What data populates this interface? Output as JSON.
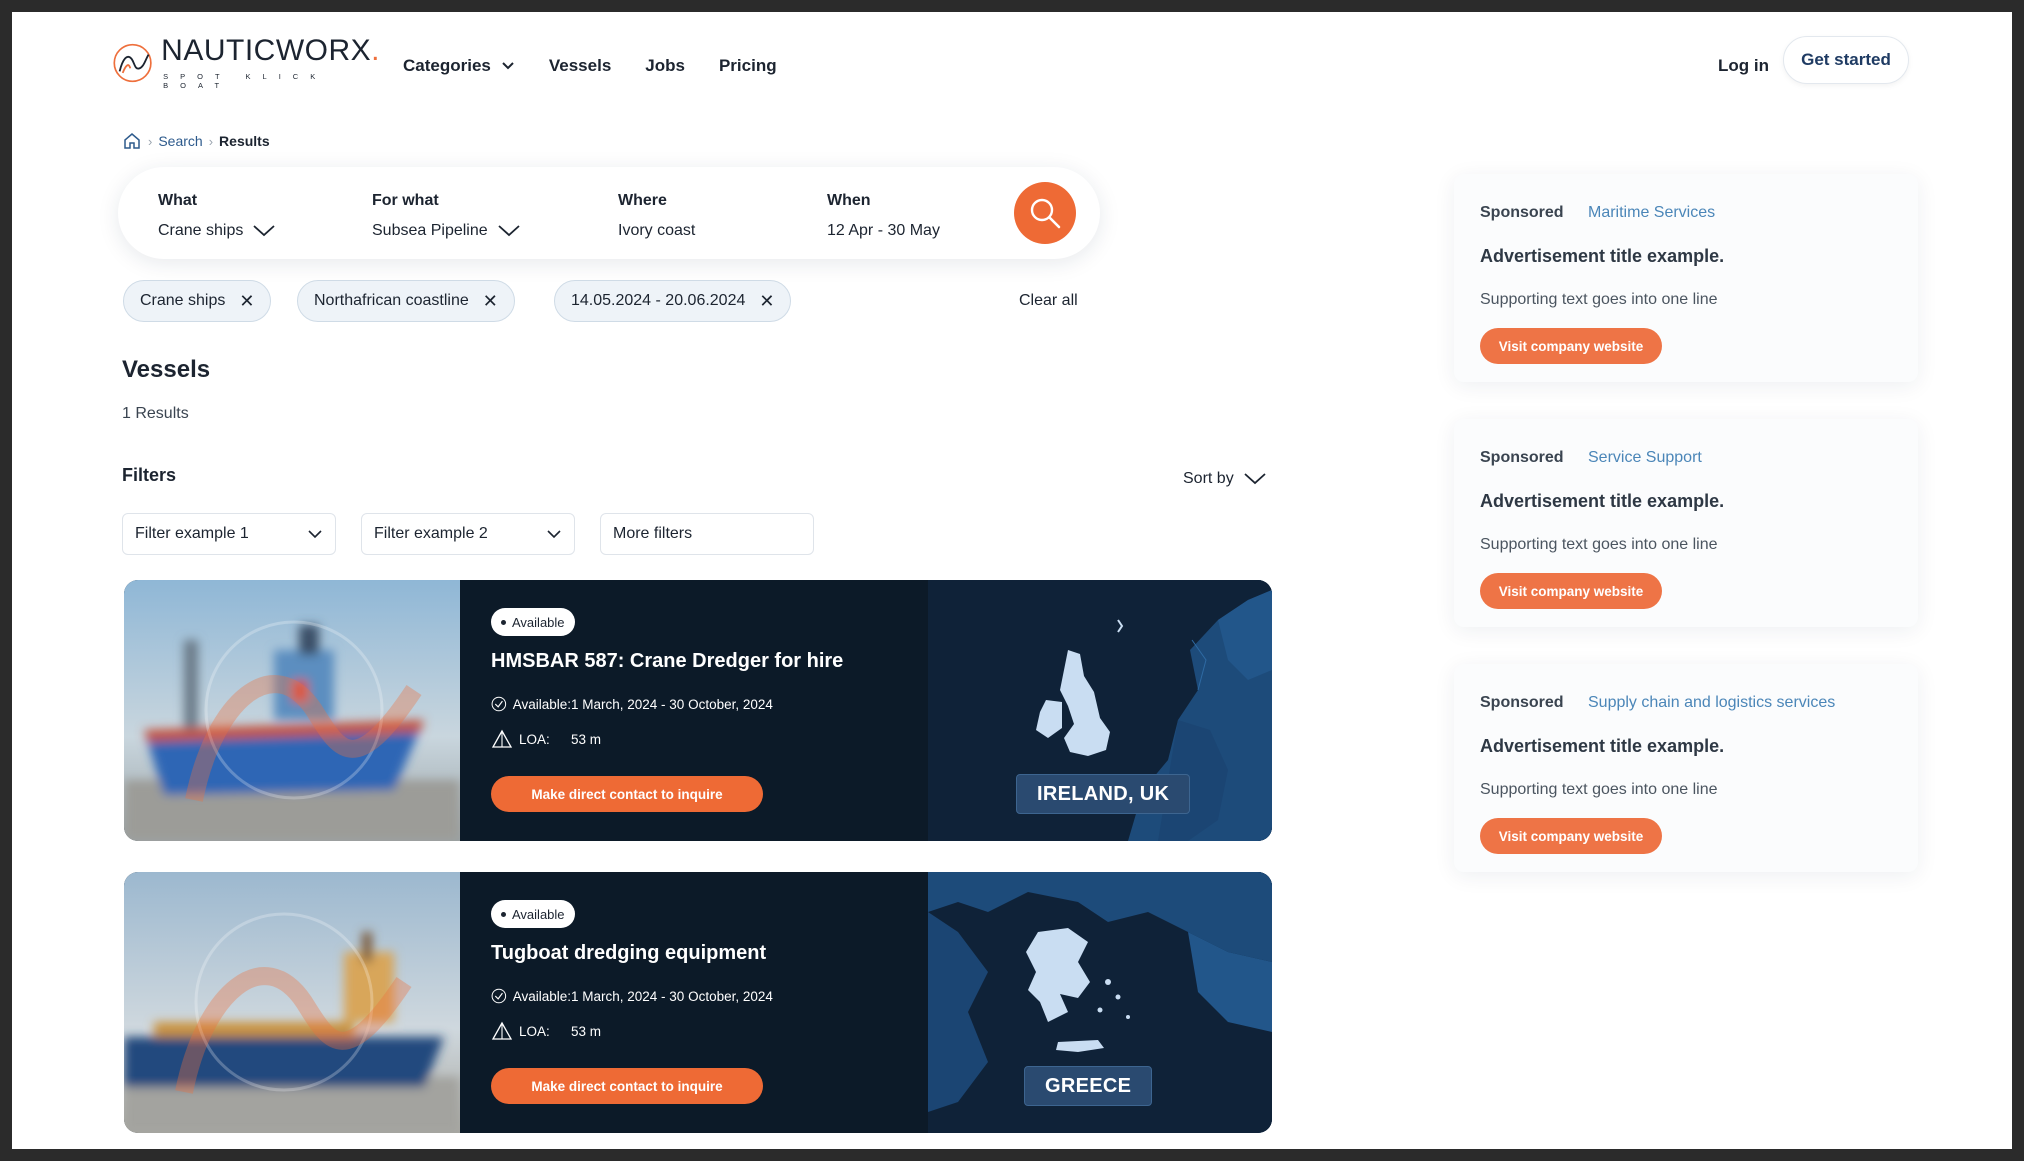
{
  "brand": {
    "name": "NAUTICWORX",
    "name_dot": ".",
    "tagline": "SPOT KLICK BOAT"
  },
  "nav": {
    "categories": "Categories",
    "vessels": "Vessels",
    "jobs": "Jobs",
    "pricing": "Pricing"
  },
  "auth": {
    "login": "Log in",
    "get_started": "Get started"
  },
  "breadcrumb": {
    "search": "Search",
    "results": "Results"
  },
  "search": {
    "what_label": "What",
    "what_value": "Crane ships",
    "forwhat_label": "For what",
    "forwhat_value": "Subsea Pipeline",
    "where_label": "Where",
    "where_value": "Ivory coast",
    "when_label": "When",
    "when_value": "12 Apr - 30 May"
  },
  "chips": [
    "Crane ships",
    "Northafrican coastline",
    "14.05.2024 - 20.06.2024"
  ],
  "clear_all": "Clear all",
  "vessels_title": "Vessels",
  "results_count": "1 Results",
  "filters_title": "Filters",
  "sort_by": "Sort by",
  "filters": [
    "Filter example 1",
    "Filter example 2",
    "More filters"
  ],
  "cards": [
    {
      "badge": "Available",
      "title": "HMSBAR 587: Crane Dredger for hire",
      "available_label": "Available:",
      "available_value": "1 March, 2024 - 30 October, 2024",
      "loa_label": "LOA:",
      "loa_value": "53 m",
      "cta": "Make direct contact to inquire",
      "region": "IRELAND, UK"
    },
    {
      "badge": "Available",
      "title": "Tugboat dredging equipment",
      "available_label": "Available:",
      "available_value": "1 March, 2024 - 30 October, 2024",
      "loa_label": "LOA:",
      "loa_value": "53 m",
      "cta": "Make direct contact to inquire",
      "region": "GREECE"
    }
  ],
  "ads": [
    {
      "sponsored": "Sponsored",
      "category": "Maritime Services",
      "title": "Advertisement title example.",
      "text": "Supporting text goes into one line",
      "button": "Visit company website"
    },
    {
      "sponsored": "Sponsored",
      "category": "Service Support",
      "title": "Advertisement title example.",
      "text": "Supporting text goes into one line",
      "button": "Visit company website"
    },
    {
      "sponsored": "Sponsored",
      "category": "Supply chain and logistics services",
      "title": "Advertisement title example.",
      "text": "Supporting text goes into one line",
      "button": "Visit company website"
    }
  ],
  "colors": {
    "accent": "#ee6a35",
    "dark": "#0c1a28",
    "map": "#1a3a60",
    "link": "#2d5a8c"
  }
}
